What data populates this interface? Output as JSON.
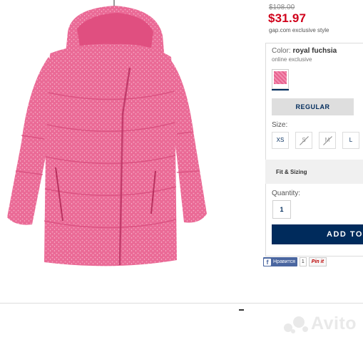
{
  "product": {
    "price_old": "$108.00",
    "price_now": "$31.97",
    "exclusive_note": "gap.com exclusive style",
    "color_label": "Color:",
    "color_value": "royal fuchsia",
    "online_note": "online exclusive",
    "fit_tab": "REGULAR",
    "size_label": "Size:",
    "sizes": [
      {
        "label": "XS",
        "available": true
      },
      {
        "label": "S",
        "available": false
      },
      {
        "label": "M",
        "available": false
      },
      {
        "label": "L",
        "available": true
      }
    ],
    "fit_sizing": "Fit & Sizing",
    "quantity_label": "Quantity:",
    "quantity_value": "1",
    "add_button": "ADD TO"
  },
  "social": {
    "fb_label": "Нравится",
    "pin_count": "1",
    "pin_label": "Pin it"
  },
  "watermark": "Avito",
  "colors": {
    "brand_navy": "#002b5c",
    "price_red": "#d0021b",
    "jacket_pink": "#e8628f"
  }
}
